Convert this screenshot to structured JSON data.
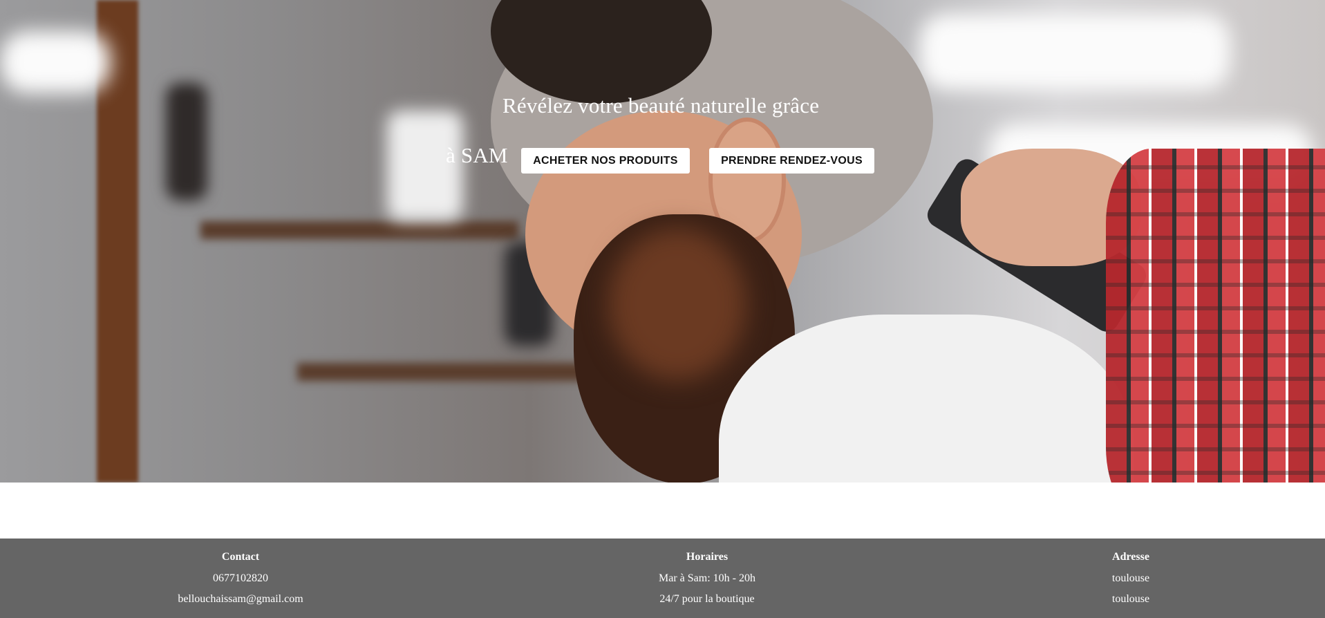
{
  "hero": {
    "title_line1": "Révélez votre beauté naturelle grâce",
    "title_line2": "à SAM",
    "buttons": {
      "products": "ACHETER NOS PRODUITS",
      "booking": "PRENDRE RENDEZ-VOUS"
    }
  },
  "footer": {
    "contact": {
      "heading": "Contact",
      "phone": "0677102820",
      "email": "bellouchaissam@gmail.com"
    },
    "hours": {
      "heading": "Horaires",
      "line1": "Mar à Sam: 10h - 20h",
      "line2": "24/7 pour la boutique"
    },
    "address": {
      "heading": "Adresse",
      "line1": "toulouse",
      "line2": "toulouse"
    }
  },
  "colors": {
    "footer_bg": "#656565",
    "button_bg": "#ffffff",
    "hero_text": "#ffffff"
  }
}
